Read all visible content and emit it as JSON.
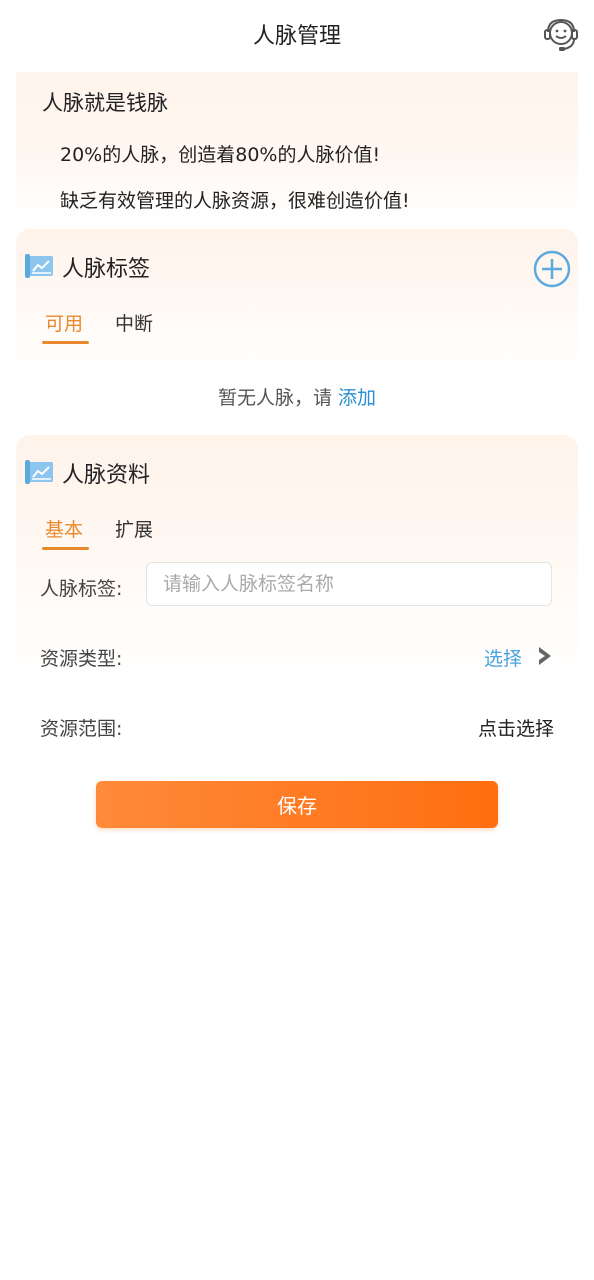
{
  "header": {
    "title": "人脉管理",
    "service_icon": "customer-service-headset-icon"
  },
  "intro": {
    "title": "人脉就是钱脉",
    "line1": "20%的人脉，创造着80%的人脉价值!",
    "line2": "缺乏有效管理的人脉资源，很难创造价值!"
  },
  "tags_section": {
    "icon": "chart-board-icon",
    "title": "人脉标签",
    "add_icon": "plus-circle-icon",
    "tabs": [
      "可用",
      "中断"
    ],
    "active_tab": "可用",
    "empty_text": "暂无人脉，请",
    "empty_link": "添加"
  },
  "info_section": {
    "icon": "chart-board-icon",
    "title": "人脉资料",
    "tabs": [
      "基本",
      "扩展"
    ],
    "active_tab": "基本",
    "fields": {
      "tag_label": "人脉标签:",
      "tag_placeholder": "请输入人脉标签名称",
      "type_label": "资源类型:",
      "type_value": "选择",
      "range_label": "资源范围:",
      "range_value": "点击选择"
    }
  },
  "save_button": "保存",
  "colors": {
    "accent_orange": "#e8892d",
    "button_orange": "#ff7a22",
    "link_blue": "#2a8fd0",
    "icon_blue": "#5aaae0"
  }
}
